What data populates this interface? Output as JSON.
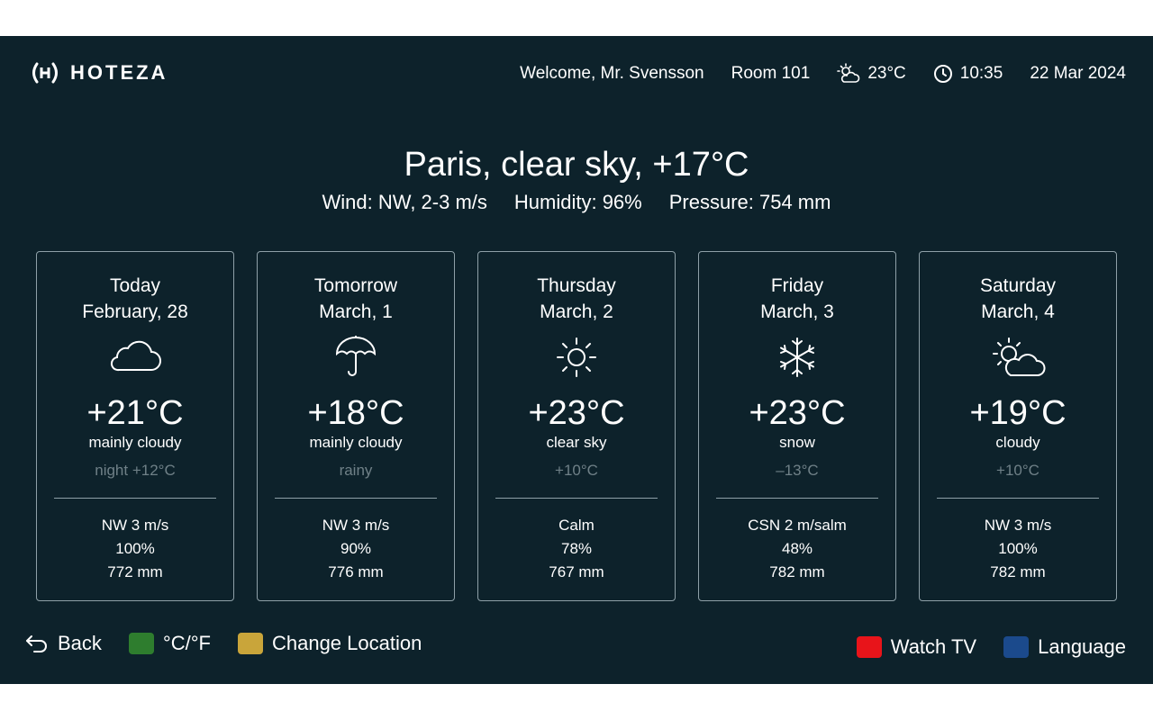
{
  "brand": {
    "name": "HOTEZA",
    "icon": "hoteza-logo-icon"
  },
  "header": {
    "welcome": "Welcome, Mr. Svensson",
    "room": "Room 101",
    "weather_temp": "23°C",
    "weather_icon": "partly-cloudy-icon",
    "time": "10:35",
    "time_icon": "clock-icon",
    "date": "22 Mar 2024"
  },
  "current": {
    "title": "Paris, clear sky, +17°C",
    "wind": "Wind: NW, 2-3 m/s",
    "humidity": "Humidity: 96%",
    "pressure": "Pressure: 754 mm"
  },
  "forecast": [
    {
      "day": "Today",
      "date": "February, 28",
      "icon": "cloud-icon",
      "temp": "+21°C",
      "condition": "mainly cloudy",
      "sub": "night +12°C",
      "wind": "NW 3 m/s",
      "humidity": "100%",
      "pressure": "772 mm"
    },
    {
      "day": "Tomorrow",
      "date": "March, 1",
      "icon": "umbrella-icon",
      "temp": "+18°C",
      "condition": "mainly cloudy",
      "sub": "rainy",
      "wind": "NW 3 m/s",
      "humidity": "90%",
      "pressure": "776 mm"
    },
    {
      "day": "Thursday",
      "date": "March, 2",
      "icon": "sun-icon",
      "temp": "+23°C",
      "condition": "clear sky",
      "sub": "+10°C",
      "wind": "Calm",
      "humidity": "78%",
      "pressure": "767 mm"
    },
    {
      "day": "Friday",
      "date": "March, 3",
      "icon": "snowflake-icon",
      "temp": "+23°C",
      "condition": "snow",
      "sub": "–13°C",
      "wind": "CSN 2 m/salm",
      "humidity": "48%",
      "pressure": "782 mm"
    },
    {
      "day": "Saturday",
      "date": "March, 4",
      "icon": "sun-cloud-icon",
      "temp": "+19°C",
      "condition": "cloudy",
      "sub": "+10°C",
      "wind": "NW 3 m/s",
      "humidity": "100%",
      "pressure": "782 mm"
    }
  ],
  "footer": {
    "back_label": "Back",
    "units_label": "°C/°F",
    "location_label": "Change Location",
    "tv_label": "Watch TV",
    "language_label": "Language",
    "colors": {
      "green": "#2e7d2e",
      "yellow": "#c9a53a",
      "red": "#e8141a",
      "blue": "#1b4a8c"
    }
  },
  "colors": {
    "background": "#0d222b",
    "border": "#8ea0a8",
    "muted_text": "#6f8087"
  }
}
